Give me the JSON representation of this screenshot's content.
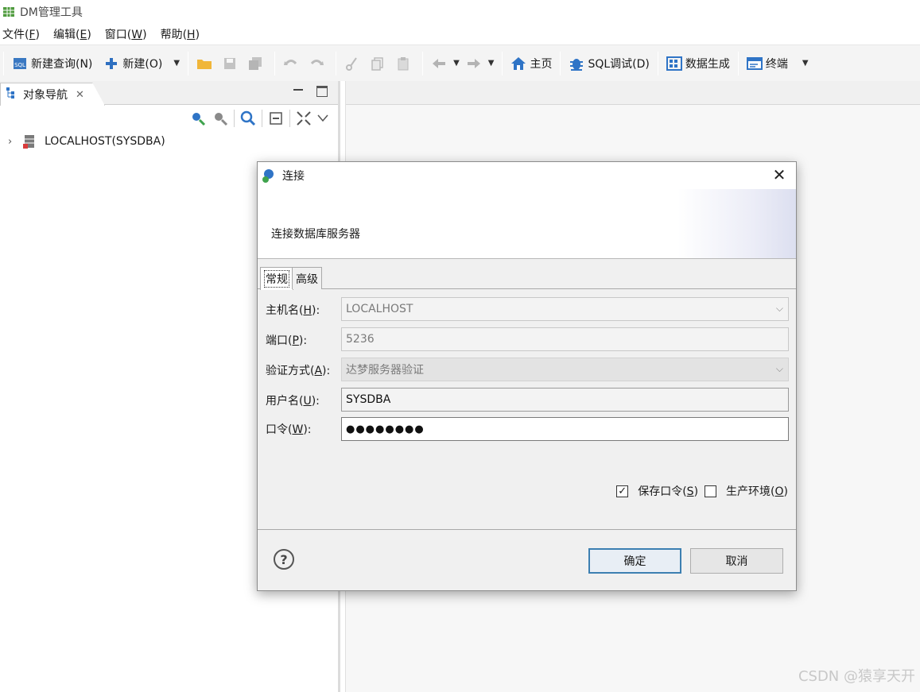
{
  "window": {
    "app_icon": "table-icon",
    "title": "DM管理工具"
  },
  "menubar": {
    "items": [
      {
        "label": "文件",
        "mnemonic": "(F)",
        "underline": "F"
      },
      {
        "label": "编辑",
        "mnemonic": "(E)",
        "underline": "E"
      },
      {
        "label": "窗口",
        "mnemonic": "(W)",
        "underline": "W"
      },
      {
        "label": "帮助",
        "mnemonic": "(H)",
        "underline": "H"
      }
    ]
  },
  "toolbar": {
    "new_query": "新建查询(N)",
    "new": "新建(O)",
    "home": "主页",
    "sql_debug": "SQL调试(D)",
    "data_gen": "数据生成",
    "terminal": "终端"
  },
  "left_panel": {
    "tab_label": "对象导航",
    "tree": [
      {
        "label": "LOCALHOST(SYSDBA)",
        "icon": "database-icon"
      }
    ]
  },
  "dialog": {
    "title": "连接",
    "subtitle": "连接数据库服务器",
    "tabs": [
      "常规",
      "高级"
    ],
    "fields": {
      "host": {
        "label": "主机名",
        "key": "H",
        "value": "LOCALHOST"
      },
      "port": {
        "label": "端口",
        "key": "P",
        "value": "5236"
      },
      "auth": {
        "label": "验证方式",
        "key": "A",
        "value": "达梦服务器验证"
      },
      "user": {
        "label": "用户名",
        "key": "U",
        "value": "SYSDBA"
      },
      "password": {
        "label": "口令",
        "key": "W",
        "value": "●●●●●●●●"
      }
    },
    "checkboxes": {
      "save_password": {
        "label": "保存口令",
        "key": "S",
        "checked": true
      },
      "production_env": {
        "label": "生产环境",
        "key": "O",
        "checked": false
      }
    },
    "buttons": {
      "ok": "确定",
      "cancel": "取消",
      "help": "?"
    }
  },
  "watermark": "CSDN @猿享天开"
}
